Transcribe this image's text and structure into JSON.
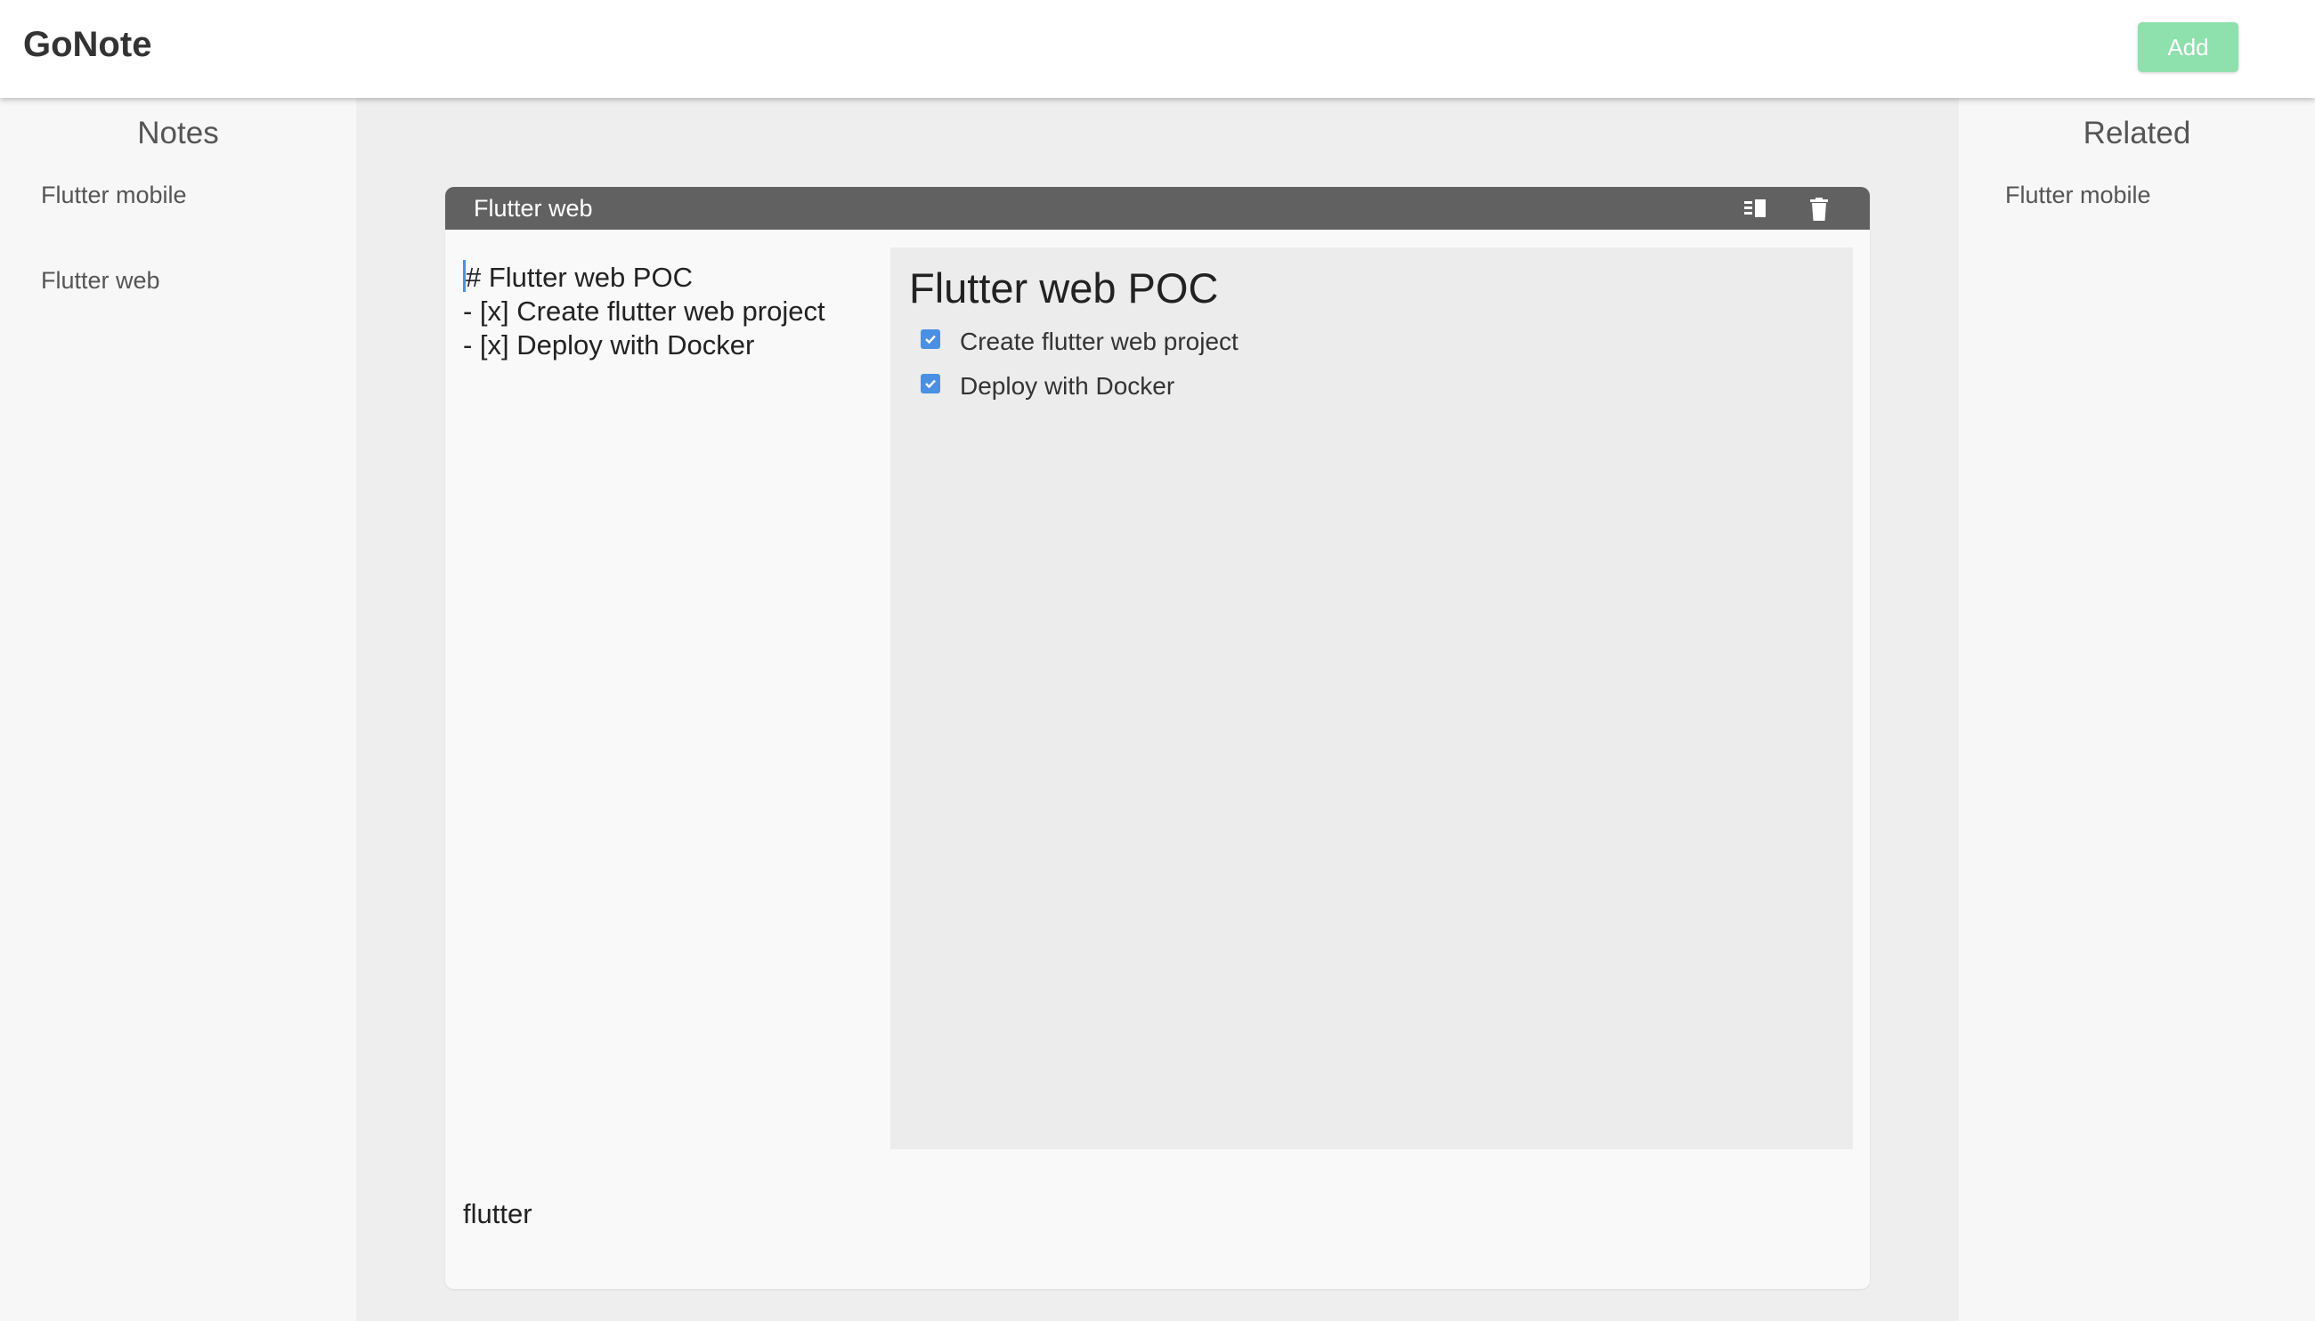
{
  "app": {
    "title": "GoNote",
    "add_label": "Add",
    "accent_color": "#8ee0ad"
  },
  "left_sidebar": {
    "heading": "Notes",
    "items": [
      {
        "label": "Flutter mobile"
      },
      {
        "label": "Flutter web"
      }
    ]
  },
  "right_sidebar": {
    "heading": "Related",
    "items": [
      {
        "label": "Flutter mobile"
      }
    ]
  },
  "note": {
    "title": "Flutter web",
    "header_color": "#616161",
    "icons": [
      "split-view-icon",
      "trash-icon"
    ],
    "editor_lines": [
      "# Flutter web POC",
      "- [x] Create flutter web project",
      "- [x] Deploy with Docker"
    ],
    "preview": {
      "heading": "Flutter web POC",
      "tasks": [
        {
          "label": "Create flutter web project",
          "checked": true
        },
        {
          "label": "Deploy with Docker",
          "checked": true
        }
      ]
    },
    "tags": "flutter"
  }
}
